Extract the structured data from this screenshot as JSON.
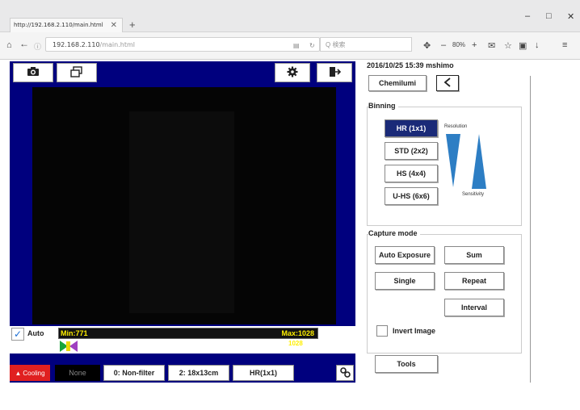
{
  "browser": {
    "tab_title": "http://192.168.2.110/main.html",
    "tab_close": "✕",
    "new_tab": "+",
    "window_controls": [
      "–",
      "□",
      "✕"
    ],
    "url_host": "192.168.2.110",
    "url_path": "/main.html",
    "search_placeholder": "Q 検索",
    "zoom": "80%"
  },
  "toolbar": {
    "camera_icon": "camera-icon",
    "window_icon": "window-icon",
    "settings_icon": "gear-icon",
    "exit_icon": "exit-icon"
  },
  "histogram": {
    "auto_label": "Auto",
    "min_label": "Min:771",
    "max_label": "Max:1028",
    "max_sub": "1028"
  },
  "statusbar": {
    "cooling_label": "Cooling",
    "filter_none": "None",
    "filter": "0: Non-filter",
    "size": "2: 18x13cm",
    "mode": "HR(1x1)"
  },
  "right": {
    "datetime_user": "2016/10/25 15:39  mshimo",
    "mode_button": "Chemilumi",
    "back_icon": "chevron-left-icon",
    "binning": {
      "legend": "Binning",
      "options": [
        "HR (1x1)",
        "STD (2x2)",
        "HS (4x4)",
        "U-HS (6x6)"
      ],
      "selected": "HR (1x1)",
      "resolution_label": "Resolution",
      "sensitivity_label": "Sensitivity"
    },
    "capture": {
      "legend": "Capture mode",
      "auto_exposure": "Auto Exposure",
      "sum": "Sum",
      "single": "Single",
      "repeat": "Repeat",
      "interval": "Interval",
      "invert_label": "Invert Image"
    },
    "tools": "Tools"
  },
  "colors": {
    "app_blue": "#00007e",
    "selected_bin": "#1a2a78",
    "cooling_red": "#e02020",
    "hist_yellow": "#ffef00"
  }
}
